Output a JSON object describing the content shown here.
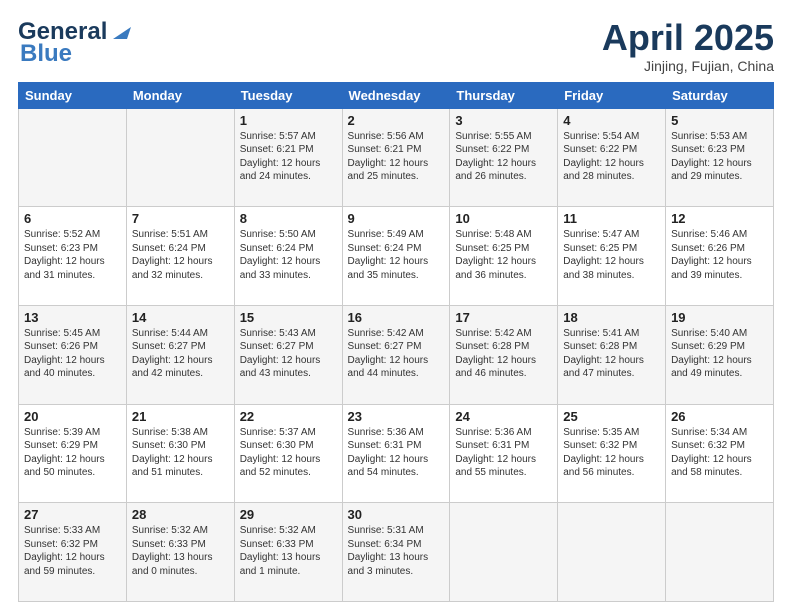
{
  "header": {
    "logo_line1": "General",
    "logo_line2": "Blue",
    "month": "April 2025",
    "location": "Jinjing, Fujian, China"
  },
  "weekdays": [
    "Sunday",
    "Monday",
    "Tuesday",
    "Wednesday",
    "Thursday",
    "Friday",
    "Saturday"
  ],
  "weeks": [
    [
      {
        "day": "",
        "sunrise": "",
        "sunset": "",
        "daylight": ""
      },
      {
        "day": "",
        "sunrise": "",
        "sunset": "",
        "daylight": ""
      },
      {
        "day": "1",
        "sunrise": "Sunrise: 5:57 AM",
        "sunset": "Sunset: 6:21 PM",
        "daylight": "Daylight: 12 hours and 24 minutes."
      },
      {
        "day": "2",
        "sunrise": "Sunrise: 5:56 AM",
        "sunset": "Sunset: 6:21 PM",
        "daylight": "Daylight: 12 hours and 25 minutes."
      },
      {
        "day": "3",
        "sunrise": "Sunrise: 5:55 AM",
        "sunset": "Sunset: 6:22 PM",
        "daylight": "Daylight: 12 hours and 26 minutes."
      },
      {
        "day": "4",
        "sunrise": "Sunrise: 5:54 AM",
        "sunset": "Sunset: 6:22 PM",
        "daylight": "Daylight: 12 hours and 28 minutes."
      },
      {
        "day": "5",
        "sunrise": "Sunrise: 5:53 AM",
        "sunset": "Sunset: 6:23 PM",
        "daylight": "Daylight: 12 hours and 29 minutes."
      }
    ],
    [
      {
        "day": "6",
        "sunrise": "Sunrise: 5:52 AM",
        "sunset": "Sunset: 6:23 PM",
        "daylight": "Daylight: 12 hours and 31 minutes."
      },
      {
        "day": "7",
        "sunrise": "Sunrise: 5:51 AM",
        "sunset": "Sunset: 6:24 PM",
        "daylight": "Daylight: 12 hours and 32 minutes."
      },
      {
        "day": "8",
        "sunrise": "Sunrise: 5:50 AM",
        "sunset": "Sunset: 6:24 PM",
        "daylight": "Daylight: 12 hours and 33 minutes."
      },
      {
        "day": "9",
        "sunrise": "Sunrise: 5:49 AM",
        "sunset": "Sunset: 6:24 PM",
        "daylight": "Daylight: 12 hours and 35 minutes."
      },
      {
        "day": "10",
        "sunrise": "Sunrise: 5:48 AM",
        "sunset": "Sunset: 6:25 PM",
        "daylight": "Daylight: 12 hours and 36 minutes."
      },
      {
        "day": "11",
        "sunrise": "Sunrise: 5:47 AM",
        "sunset": "Sunset: 6:25 PM",
        "daylight": "Daylight: 12 hours and 38 minutes."
      },
      {
        "day": "12",
        "sunrise": "Sunrise: 5:46 AM",
        "sunset": "Sunset: 6:26 PM",
        "daylight": "Daylight: 12 hours and 39 minutes."
      }
    ],
    [
      {
        "day": "13",
        "sunrise": "Sunrise: 5:45 AM",
        "sunset": "Sunset: 6:26 PM",
        "daylight": "Daylight: 12 hours and 40 minutes."
      },
      {
        "day": "14",
        "sunrise": "Sunrise: 5:44 AM",
        "sunset": "Sunset: 6:27 PM",
        "daylight": "Daylight: 12 hours and 42 minutes."
      },
      {
        "day": "15",
        "sunrise": "Sunrise: 5:43 AM",
        "sunset": "Sunset: 6:27 PM",
        "daylight": "Daylight: 12 hours and 43 minutes."
      },
      {
        "day": "16",
        "sunrise": "Sunrise: 5:42 AM",
        "sunset": "Sunset: 6:27 PM",
        "daylight": "Daylight: 12 hours and 44 minutes."
      },
      {
        "day": "17",
        "sunrise": "Sunrise: 5:42 AM",
        "sunset": "Sunset: 6:28 PM",
        "daylight": "Daylight: 12 hours and 46 minutes."
      },
      {
        "day": "18",
        "sunrise": "Sunrise: 5:41 AM",
        "sunset": "Sunset: 6:28 PM",
        "daylight": "Daylight: 12 hours and 47 minutes."
      },
      {
        "day": "19",
        "sunrise": "Sunrise: 5:40 AM",
        "sunset": "Sunset: 6:29 PM",
        "daylight": "Daylight: 12 hours and 49 minutes."
      }
    ],
    [
      {
        "day": "20",
        "sunrise": "Sunrise: 5:39 AM",
        "sunset": "Sunset: 6:29 PM",
        "daylight": "Daylight: 12 hours and 50 minutes."
      },
      {
        "day": "21",
        "sunrise": "Sunrise: 5:38 AM",
        "sunset": "Sunset: 6:30 PM",
        "daylight": "Daylight: 12 hours and 51 minutes."
      },
      {
        "day": "22",
        "sunrise": "Sunrise: 5:37 AM",
        "sunset": "Sunset: 6:30 PM",
        "daylight": "Daylight: 12 hours and 52 minutes."
      },
      {
        "day": "23",
        "sunrise": "Sunrise: 5:36 AM",
        "sunset": "Sunset: 6:31 PM",
        "daylight": "Daylight: 12 hours and 54 minutes."
      },
      {
        "day": "24",
        "sunrise": "Sunrise: 5:36 AM",
        "sunset": "Sunset: 6:31 PM",
        "daylight": "Daylight: 12 hours and 55 minutes."
      },
      {
        "day": "25",
        "sunrise": "Sunrise: 5:35 AM",
        "sunset": "Sunset: 6:32 PM",
        "daylight": "Daylight: 12 hours and 56 minutes."
      },
      {
        "day": "26",
        "sunrise": "Sunrise: 5:34 AM",
        "sunset": "Sunset: 6:32 PM",
        "daylight": "Daylight: 12 hours and 58 minutes."
      }
    ],
    [
      {
        "day": "27",
        "sunrise": "Sunrise: 5:33 AM",
        "sunset": "Sunset: 6:32 PM",
        "daylight": "Daylight: 12 hours and 59 minutes."
      },
      {
        "day": "28",
        "sunrise": "Sunrise: 5:32 AM",
        "sunset": "Sunset: 6:33 PM",
        "daylight": "Daylight: 13 hours and 0 minutes."
      },
      {
        "day": "29",
        "sunrise": "Sunrise: 5:32 AM",
        "sunset": "Sunset: 6:33 PM",
        "daylight": "Daylight: 13 hours and 1 minute."
      },
      {
        "day": "30",
        "sunrise": "Sunrise: 5:31 AM",
        "sunset": "Sunset: 6:34 PM",
        "daylight": "Daylight: 13 hours and 3 minutes."
      },
      {
        "day": "",
        "sunrise": "",
        "sunset": "",
        "daylight": ""
      },
      {
        "day": "",
        "sunrise": "",
        "sunset": "",
        "daylight": ""
      },
      {
        "day": "",
        "sunrise": "",
        "sunset": "",
        "daylight": ""
      }
    ]
  ]
}
